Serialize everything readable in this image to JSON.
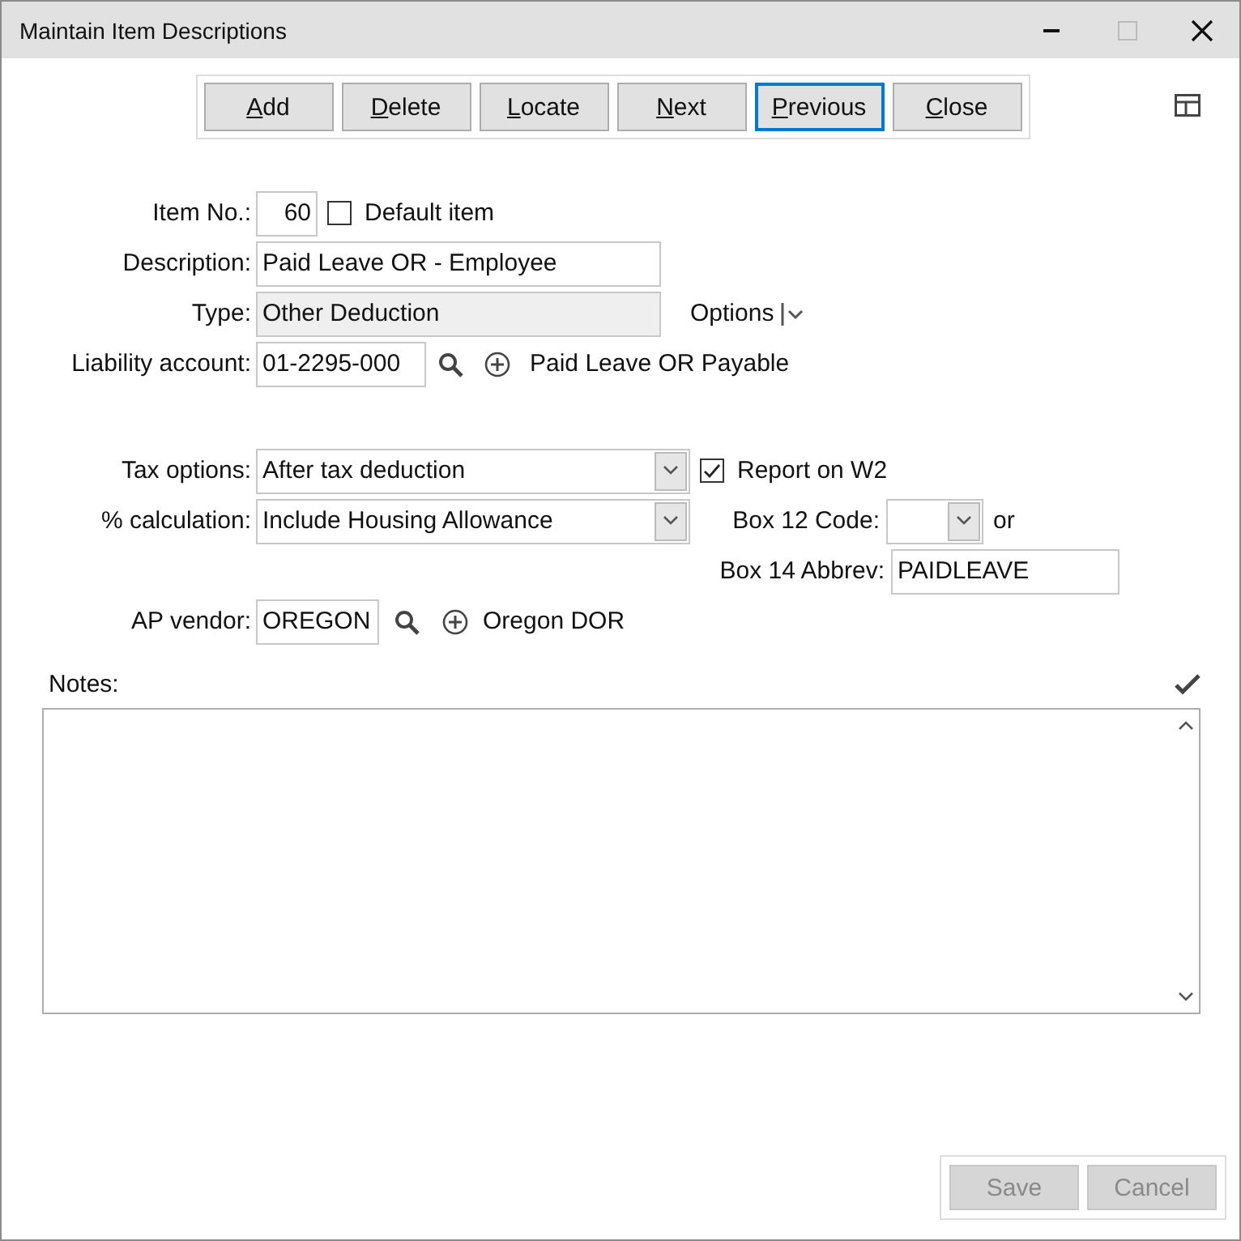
{
  "window": {
    "title": "Maintain Item Descriptions"
  },
  "toolbar": [
    {
      "label": "Add",
      "focused": false
    },
    {
      "label": "Delete",
      "focused": false
    },
    {
      "label": "Locate",
      "focused": false
    },
    {
      "label": "Next",
      "focused": false
    },
    {
      "label": "Previous",
      "focused": true
    },
    {
      "label": "Close",
      "focused": false
    }
  ],
  "item_no": {
    "label": "Item No.:",
    "value": "60"
  },
  "default_item": {
    "label": "Default item",
    "checked": false
  },
  "description": {
    "label": "Description:",
    "value": "Paid Leave OR - Employee"
  },
  "type": {
    "label": "Type:",
    "value": "Other Deduction",
    "disabled": true
  },
  "options": {
    "label": "Options"
  },
  "liability_account": {
    "label": "Liability account:",
    "value": "01-2295-000",
    "name": "Paid Leave OR Payable"
  },
  "tax_options": {
    "label": "Tax options:",
    "value": "After tax deduction"
  },
  "report_w2": {
    "label": "Report on W2",
    "checked": true
  },
  "percent_calculation": {
    "label": "% calculation:",
    "value": "Include Housing Allowance"
  },
  "box12": {
    "label": "Box 12 Code:",
    "suffix": "or"
  },
  "box14": {
    "label": "Box 14 Abbrev:",
    "value": "PAIDLEAVE"
  },
  "ap_vendor": {
    "label": "AP vendor:",
    "value": "OREGON",
    "name": "Oregon DOR"
  },
  "notes": {
    "label": "Notes:"
  },
  "footer": [
    {
      "label": "Save",
      "disabled": true
    },
    {
      "label": "Cancel",
      "disabled": true
    }
  ]
}
